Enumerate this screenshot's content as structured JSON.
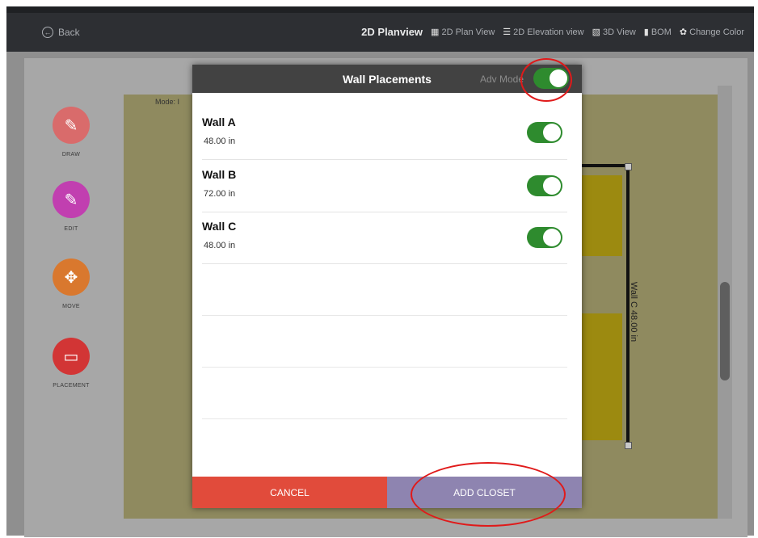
{
  "topbar": {
    "back_label": "Back",
    "title": "2D Planview",
    "nav": [
      {
        "label": "2D Plan View",
        "icon": "plan-view-icon"
      },
      {
        "label": "2D Elevation view",
        "icon": "elevation-view-icon"
      },
      {
        "label": "3D View",
        "icon": "3d-view-icon"
      },
      {
        "label": "BOM",
        "icon": "bom-icon"
      },
      {
        "label": "Change Color",
        "icon": "palette-icon"
      }
    ]
  },
  "canvas": {
    "mode_label": "Mode: I",
    "wall_c_label": "Wall C 48.00 in"
  },
  "tools": [
    {
      "label": "DRAW",
      "icon": "pencil-icon",
      "color": "#d96b6b"
    },
    {
      "label": "EDIT",
      "icon": "ruler-icon",
      "color": "#c13fb0"
    },
    {
      "label": "MOVE",
      "icon": "move-arrows-icon",
      "color": "#d9782e"
    },
    {
      "label": "PLACEMENT",
      "icon": "placement-icon",
      "color": "#d23535"
    }
  ],
  "modal": {
    "title": "Wall Placements",
    "adv_mode_label": "Adv Mode",
    "adv_mode_on": true,
    "walls": [
      {
        "name": "Wall A",
        "length": "48.00 in",
        "enabled": true
      },
      {
        "name": "Wall B",
        "length": "72.00 in",
        "enabled": true
      },
      {
        "name": "Wall C",
        "length": "48.00 in",
        "enabled": true
      }
    ],
    "cancel_label": "CANCEL",
    "add_label": "ADD CLOSET"
  },
  "colors": {
    "toggle_on": "#2e8b2e",
    "cancel": "#e14b3b",
    "add": "#8e84b0",
    "annotation": "#e01a1a"
  }
}
